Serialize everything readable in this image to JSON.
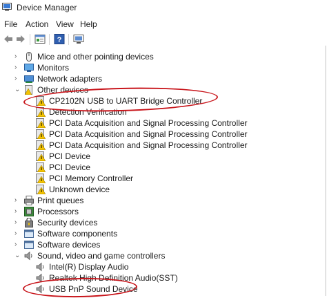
{
  "window": {
    "title": "Device Manager"
  },
  "menu": {
    "file": "File",
    "action": "Action",
    "view": "View",
    "help": "Help"
  },
  "toolbar": {
    "back_icon": "back-arrow-icon",
    "forward_icon": "forward-arrow-icon",
    "properties_icon": "properties-icon",
    "help_icon": "help-icon",
    "scan_icon": "scan-hardware-icon"
  },
  "tree": {
    "mice": "Mice and other pointing devices",
    "monitors": "Monitors",
    "network": "Network adapters",
    "other": "Other devices",
    "other_children": [
      "CP2102N USB to UART Bridge Controller",
      "Detection Verification",
      "PCI Data Acquisition and Signal Processing Controller",
      "PCI Data Acquisition and Signal Processing Controller",
      "PCI Data Acquisition and Signal Processing Controller",
      "PCI Device",
      "PCI Device",
      "PCI Memory Controller",
      "Unknown device"
    ],
    "print": "Print queues",
    "processors": "Processors",
    "security": "Security devices",
    "swcomp": "Software components",
    "swdev": "Software devices",
    "sound": "Sound, video and game controllers",
    "sound_children": [
      "Intel(R) Display Audio",
      "Realtek High Definition Audio(SST)",
      "USB PnP Sound Device"
    ]
  },
  "colors": {
    "annotation": "#c8151b",
    "warning": "#f2c200"
  }
}
